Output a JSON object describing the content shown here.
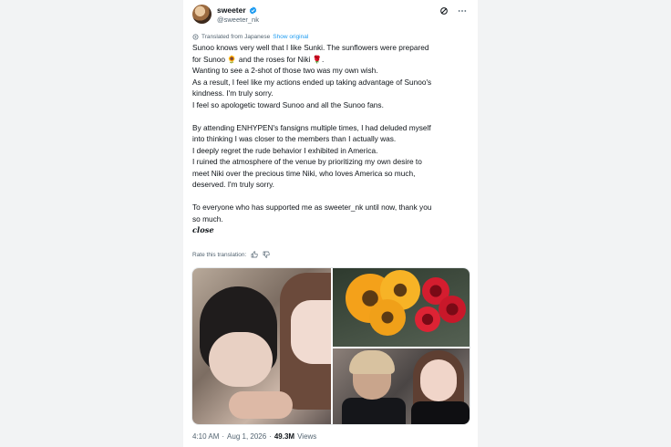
{
  "author": {
    "display_name": "sweeter",
    "handle": "@sweeter_nk",
    "verified": true,
    "badge_color": "#1d9bf0"
  },
  "header_icons": [
    "grok-icon",
    "more-icon"
  ],
  "translation": {
    "label": "Translated from Japanese",
    "show_original": "Show original"
  },
  "post": {
    "lines": [
      "Sunoo knows very well that I like Sunki. The sunflowers were prepared",
      "for Sunoo 🌻 and the roses for Niki 🌹.",
      "Wanting to see a 2-shot of those two was my own wish.",
      "As a result, I feel like my actions ended up taking advantage of Sunoo's",
      "kindness. I'm truly sorry.",
      "I feel so apologetic toward Sunoo and all the Sunoo fans.",
      "By attending ENHYPEN's fansigns multiple times, I had deluded myself",
      "into thinking I was closer to the members than I actually was.",
      "I deeply regret the rude behavior I exhibited in America.",
      "I ruined the atmosphere of the venue by prioritizing my own desire to",
      "meet Niki over the precious time Niki, who loves America so much,",
      "deserved. I'm truly sorry.",
      "To everyone who has supported me as sweeter_nk until now, thank you",
      "so much.",
      "close"
    ]
  },
  "rate_translation": "Rate this translation:",
  "media": {
    "photos": [
      "selfie of two people",
      "sunflowers and red roses bouquet",
      "two people posing at fansign"
    ]
  },
  "meta": {
    "time": "4:10 AM",
    "separator": "·",
    "date": "Aug 1, 2026",
    "separator2": "·",
    "views_count": "49.3M",
    "views_label": "Views"
  },
  "colors": {
    "text": "#0f1419",
    "secondary": "#536471",
    "link": "#1d9bf0"
  }
}
